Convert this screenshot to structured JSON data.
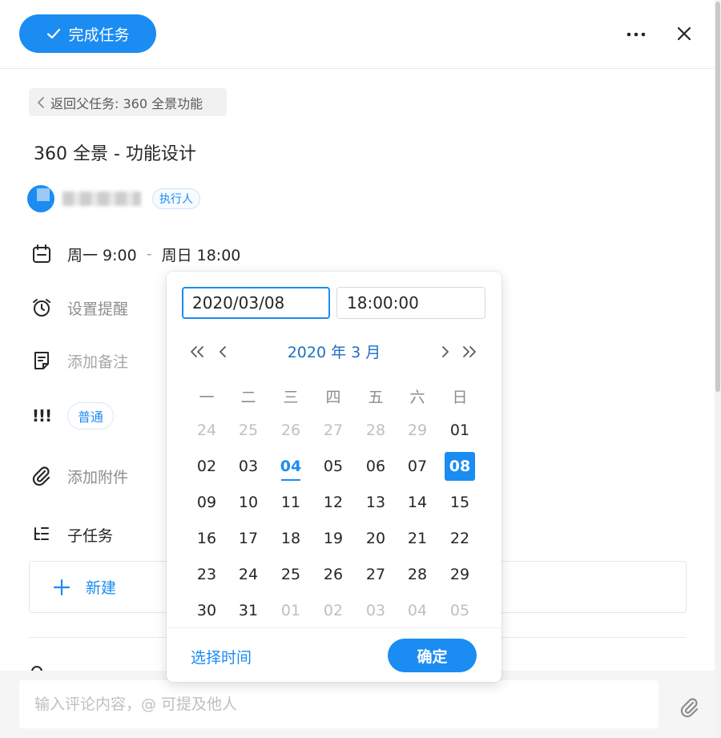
{
  "header": {
    "complete_label": "完成任务"
  },
  "back_link": {
    "label": "返回父任务: 360 全景功能"
  },
  "task": {
    "title": "360 全景 - 功能设计"
  },
  "assignee": {
    "role": "执行人"
  },
  "schedule": {
    "start": "周一 9:00",
    "separator": "-",
    "end": "周日 18:00"
  },
  "reminder": {
    "label": "设置提醒"
  },
  "note": {
    "label": "添加备注"
  },
  "priority": {
    "label": "普通"
  },
  "attachment": {
    "label": "添加附件"
  },
  "subtasks": {
    "label": "子任务",
    "new_label": "新建"
  },
  "comment": {
    "placeholder": "输入评论内容，@ 可提及他人"
  },
  "picker": {
    "date_value": "2020/03/08",
    "time_value": "18:00:00",
    "month_label": "2020 年 3 月",
    "weekdays": [
      "一",
      "二",
      "三",
      "四",
      "五",
      "六",
      "日"
    ],
    "weeks": [
      [
        "24",
        "25",
        "26",
        "27",
        "28",
        "29",
        "01"
      ],
      [
        "02",
        "03",
        "04",
        "05",
        "06",
        "07",
        "08"
      ],
      [
        "09",
        "10",
        "11",
        "12",
        "13",
        "14",
        "15"
      ],
      [
        "16",
        "17",
        "18",
        "19",
        "20",
        "21",
        "22"
      ],
      [
        "23",
        "24",
        "25",
        "26",
        "27",
        "28",
        "29"
      ],
      [
        "30",
        "31",
        "01",
        "02",
        "03",
        "04",
        "05"
      ]
    ],
    "today": "04",
    "selected": "08",
    "select_time_label": "选择时间",
    "confirm_label": "确定"
  },
  "colors": {
    "accent": "#1b8cf2",
    "month_text": "#1e6fc4",
    "muted_text": "#bfbfbf"
  }
}
